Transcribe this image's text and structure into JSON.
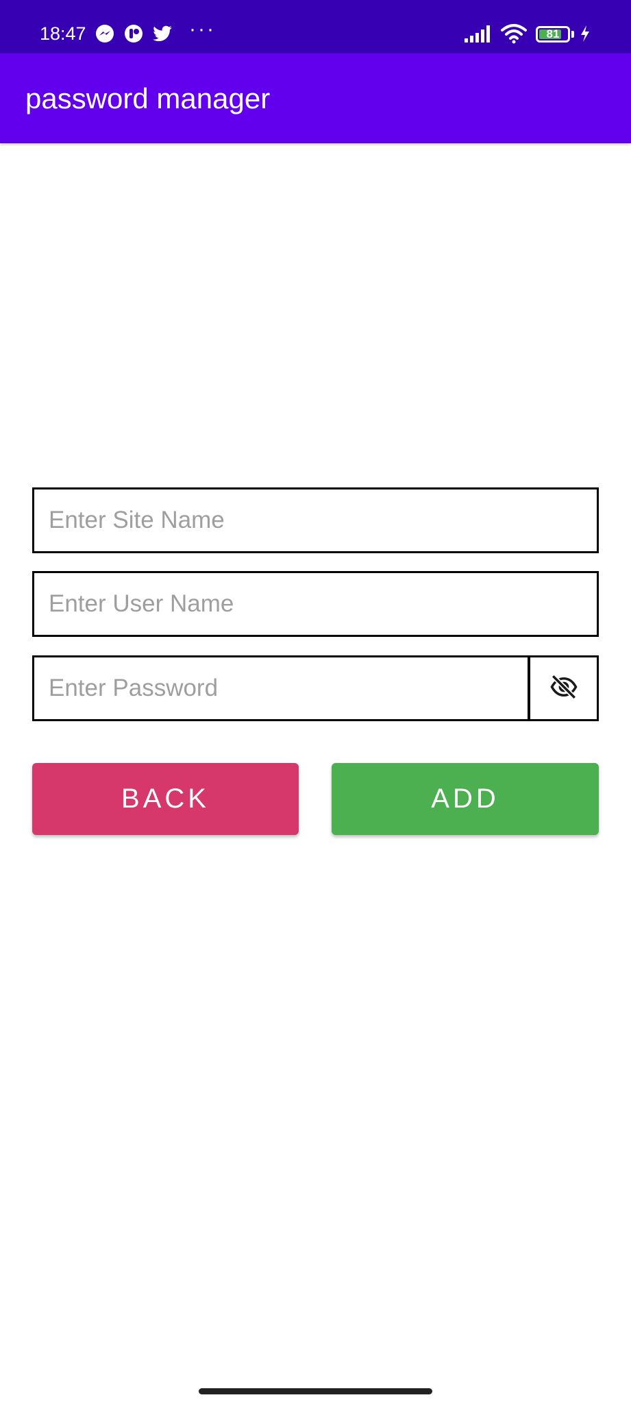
{
  "status_bar": {
    "time": "18:47",
    "more_notifications": "···",
    "battery_level": "81",
    "battery_fraction": 0.81,
    "icons": [
      "messenger-icon",
      "app-notification-icon",
      "twitter-icon",
      "signal-icon",
      "wifi-icon",
      "battery-icon",
      "charging-icon"
    ],
    "color": "#3700B3"
  },
  "app_bar": {
    "title": "password manager",
    "color": "#6200EE"
  },
  "form": {
    "site_name_placeholder": "Enter Site Name",
    "user_name_placeholder": "Enter User Name",
    "password_placeholder": "Enter Password",
    "toggle_icon": "eye-off-icon"
  },
  "buttons": {
    "back_label": "BACK",
    "add_label": "ADD",
    "back_color": "#D6386B",
    "add_color": "#4CAF50"
  }
}
